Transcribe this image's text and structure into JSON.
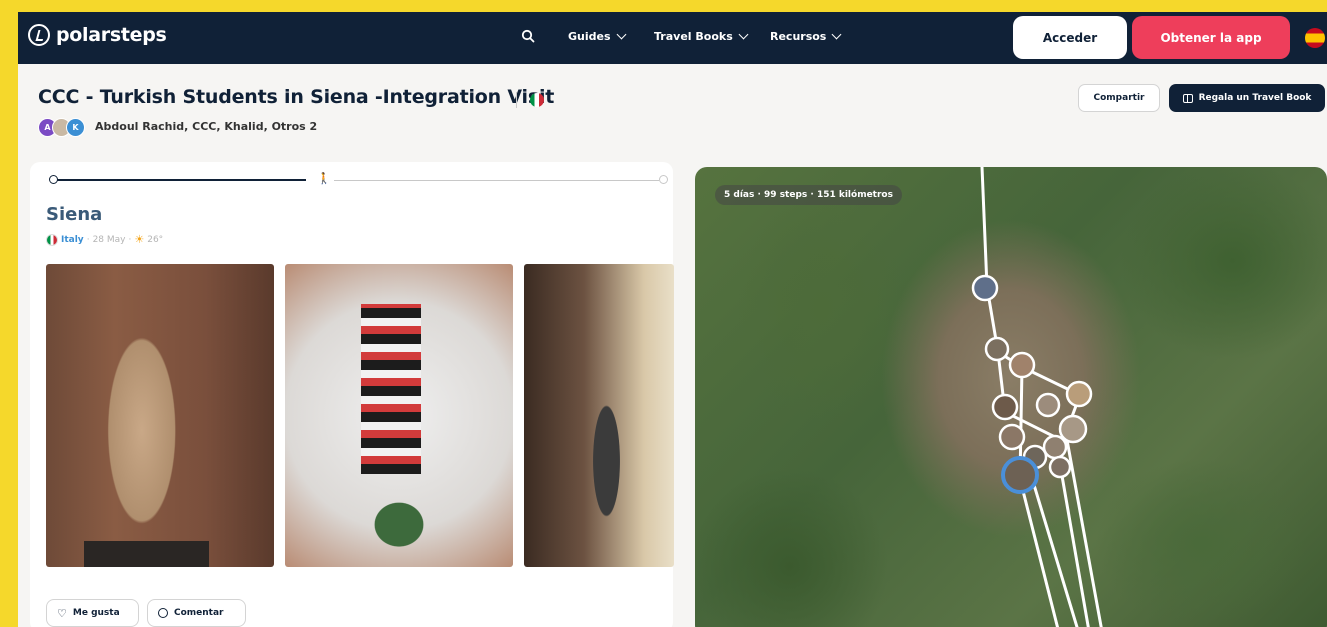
{
  "header": {
    "logo_text": "polarsteps",
    "nav": [
      {
        "label": "Guides"
      },
      {
        "label": "Travel Books"
      },
      {
        "label": "Recursos"
      }
    ],
    "login_label": "Acceder",
    "get_app_label": "Obtener la app",
    "language": "es"
  },
  "trip": {
    "title": "CCC - Turkish Students in Siena -Integration Visit",
    "participants": "Abdoul Rachid, CCC, Khalid, Otros 2",
    "avatar_initials": [
      "A",
      "",
      "K"
    ],
    "share_label": "Compartir",
    "gift_label": "Regala un Travel Book"
  },
  "step": {
    "title": "Siena",
    "country": "Italy",
    "date": "28 May",
    "temperature": "26°",
    "like_label": "Me gusta",
    "comment_label": "Comentar"
  },
  "map": {
    "stats": "5 días · 99 steps · 151 kilómetros"
  },
  "colors": {
    "navy": "#102137",
    "brand_pink": "#ee3e5b",
    "page_border": "#f5d82b",
    "link_blue": "#3b8fd4"
  }
}
